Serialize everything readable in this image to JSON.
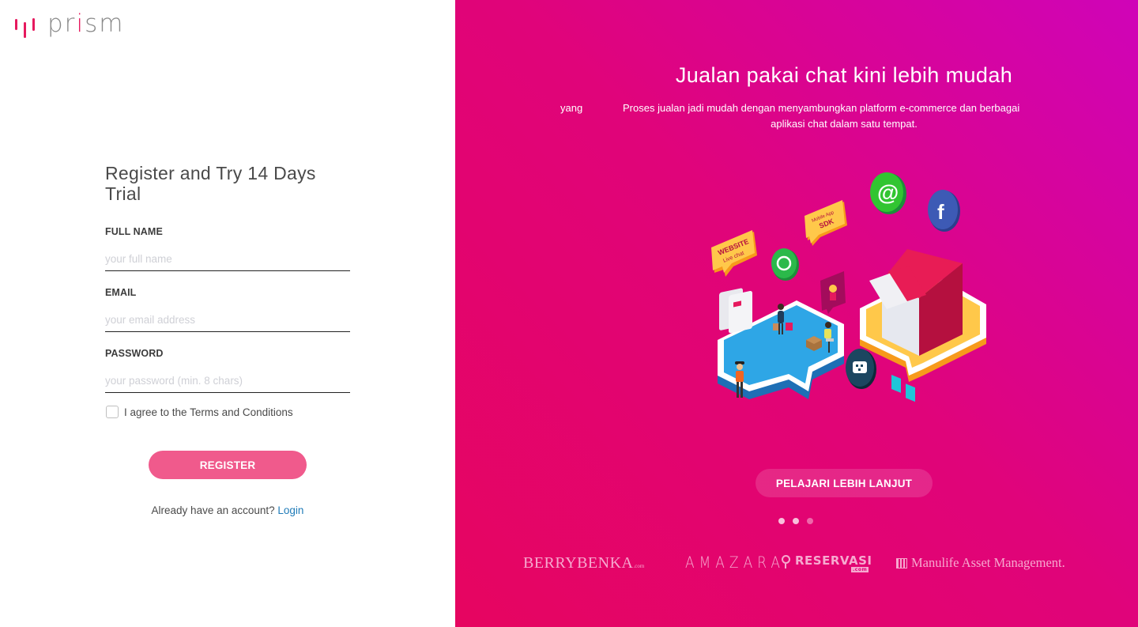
{
  "brand": {
    "name_prefix": "pr",
    "name_i": "i",
    "name_suffix": "sm",
    "accent_color": "#e6195e"
  },
  "form": {
    "title": "Register and Try 14 Days Trial",
    "fields": [
      {
        "label": "FULL NAME",
        "placeholder": "your full name",
        "value": ""
      },
      {
        "label": "EMAIL",
        "placeholder": "your email address",
        "value": ""
      },
      {
        "label": "PASSWORD",
        "placeholder": "your password (min. 8 chars)",
        "value": ""
      }
    ],
    "agree_label": "I agree to the Terms and Conditions",
    "agree_checked": false,
    "register_label": "REGISTER",
    "login_prompt": "Already have an account?",
    "login_label": "Login",
    "button_color": "#f05a8c",
    "link_color": "#1f7bb8"
  },
  "hero": {
    "title": "Jualan pakai chat kini lebih mudah",
    "stray_word": "yang",
    "subtitle_line1": "Proses jualan jadi mudah dengan menyambungkan platform e-commerce dan berbagai",
    "subtitle_line2": "aplikasi chat dalam satu tempat.",
    "illustration_labels": {
      "website": "WEBSITE",
      "website_sub": "Live chat",
      "sdk_top": "Mobile App",
      "sdk": "SDK"
    },
    "learn_more_label": "PELAJARI LEBIH LANJUT",
    "carousel": {
      "total": 3,
      "active_indices": [
        0,
        1
      ]
    },
    "gradient": [
      "#cf04b8",
      "#e0047a",
      "#e60560"
    ]
  },
  "partners": [
    {
      "name": "BERRYBENKA",
      "suffix": ".com"
    },
    {
      "name": "AMAZARA"
    },
    {
      "name": "RESERVASI",
      "suffix": ".com"
    },
    {
      "name": "Manulife Asset Management",
      "suffix": "."
    }
  ]
}
